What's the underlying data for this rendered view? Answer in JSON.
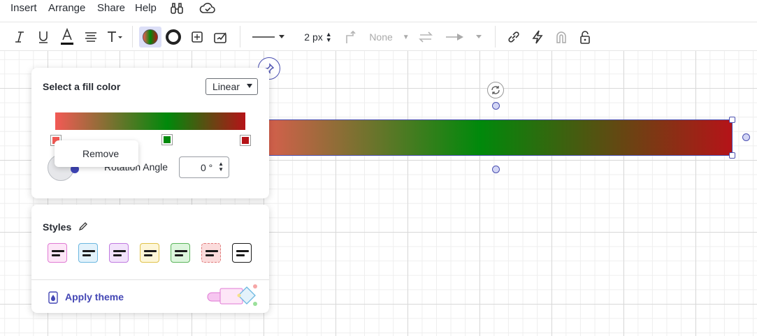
{
  "menubar": {
    "items": [
      "Insert",
      "Arrange",
      "Share",
      "Help"
    ],
    "icons": [
      "binoculars-icon",
      "cloud-check-icon"
    ]
  },
  "toolbar": {
    "line_width": "2 px",
    "arrow_start": "None",
    "icons": [
      "italic-icon",
      "underline-icon",
      "text-color-icon",
      "align-icon",
      "text-size-icon",
      "fill-color-icon",
      "line-color-icon",
      "shape-options-icon",
      "format-painter-icon",
      "line-style-icon",
      "line-width-icon",
      "connector-icon",
      "arrow-start-icon",
      "swap-arrows-icon",
      "arrow-end-icon",
      "link-icon",
      "lightning-icon",
      "magnet-icon",
      "lock-icon"
    ],
    "colors": {
      "text_underline": "#000000"
    }
  },
  "fill_panel": {
    "title": "Select a fill color",
    "type_select": "Linear",
    "gradient": {
      "stops": [
        {
          "color": "#f25a55",
          "position": 0
        },
        {
          "color": "#00890b",
          "position": 0.59
        },
        {
          "color": "#b51318",
          "position": 1
        }
      ]
    },
    "context_menu": "Remove",
    "rotation_label": "Rotation Angle",
    "rotation_value": "0 °"
  },
  "styles_panel": {
    "title": "Styles",
    "swatches": [
      {
        "bg": "#fde6f7",
        "border": "#e07ad4"
      },
      {
        "bg": "#e3f2fb",
        "border": "#6cb7e0"
      },
      {
        "bg": "#f2e3fb",
        "border": "#c07ae0"
      },
      {
        "bg": "#fdf6d8",
        "border": "#e0c24a"
      },
      {
        "bg": "#ddf5dd",
        "border": "#5ab55a"
      },
      {
        "bg": "#fbdcdc",
        "border": "#e07a7a"
      },
      {
        "bg": "#ffffff",
        "border": "#1a1a1a"
      }
    ],
    "apply_theme": "Apply theme"
  },
  "canvas": {
    "shape_gradient": [
      "#f25a55",
      "#00890b",
      "#b51318"
    ],
    "selection_color": "#4a4fb0"
  }
}
